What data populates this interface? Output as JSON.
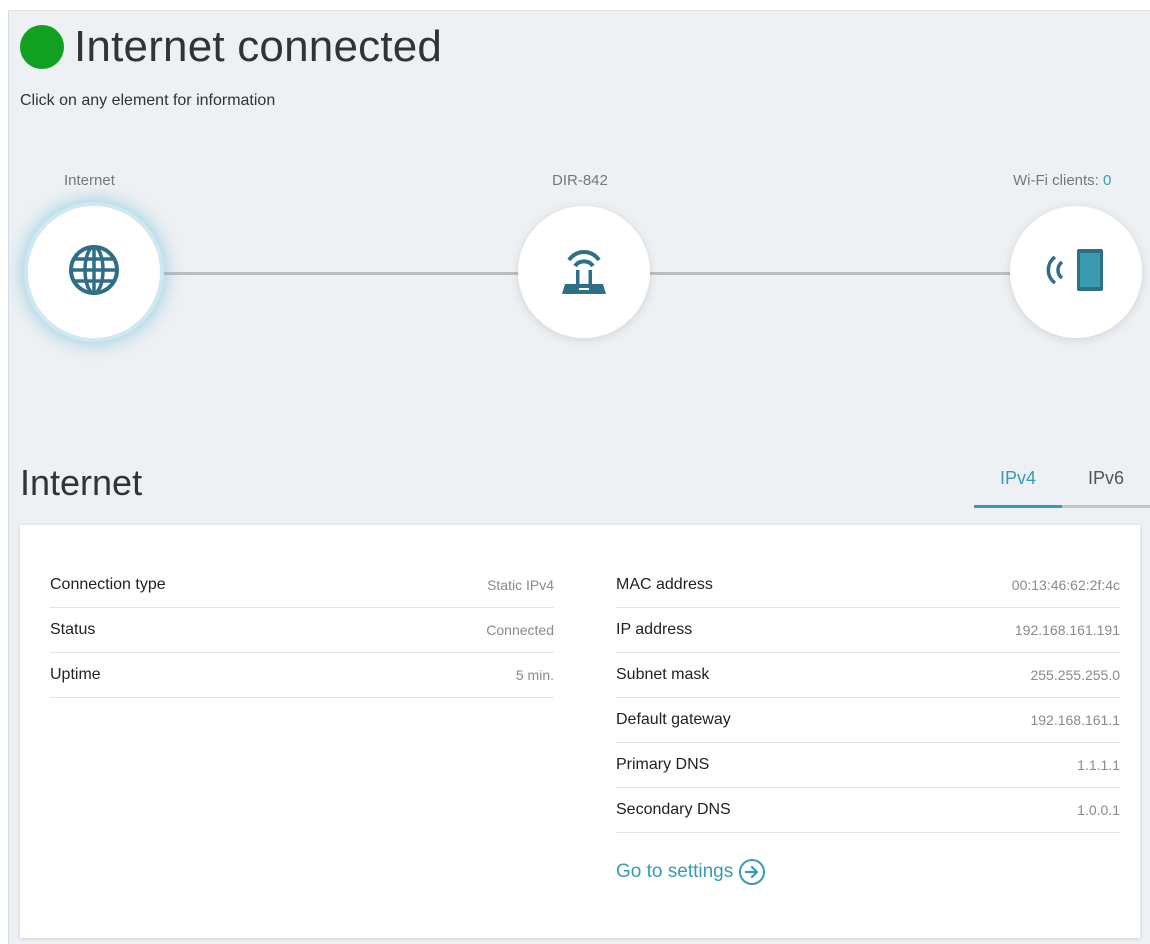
{
  "header": {
    "title": "Internet connected",
    "hint": "Click on any element for information",
    "status_color": "#12a021"
  },
  "topology": {
    "internet": {
      "label": "Internet",
      "icon": "globe-icon"
    },
    "router": {
      "label": "DIR-842",
      "icon": "router-icon"
    },
    "clients": {
      "label": "Wi-Fi clients: ",
      "count": "0",
      "icon": "wifi-device-icon"
    }
  },
  "section": {
    "title": "Internet",
    "tabs": [
      {
        "label": "IPv4",
        "active": true
      },
      {
        "label": "IPv6",
        "active": false
      }
    ]
  },
  "left_info": [
    {
      "key": "Connection type",
      "value": "Static IPv4"
    },
    {
      "key": "Status",
      "value": "Connected"
    },
    {
      "key": "Uptime",
      "value": "5 min."
    }
  ],
  "right_info": [
    {
      "key": "MAC address",
      "value": "00:13:46:62:2f:4c"
    },
    {
      "key": "IP address",
      "value": "192.168.161.191"
    },
    {
      "key": "Subnet mask",
      "value": "255.255.255.0"
    },
    {
      "key": "Default gateway",
      "value": "192.168.161.1"
    },
    {
      "key": "Primary DNS",
      "value": "1.1.1.1"
    },
    {
      "key": "Secondary DNS",
      "value": "1.0.0.1"
    }
  ],
  "actions": {
    "go_to_settings": "Go to settings"
  },
  "colors": {
    "accent": "#3a9bb0",
    "connected": "#12a021"
  }
}
